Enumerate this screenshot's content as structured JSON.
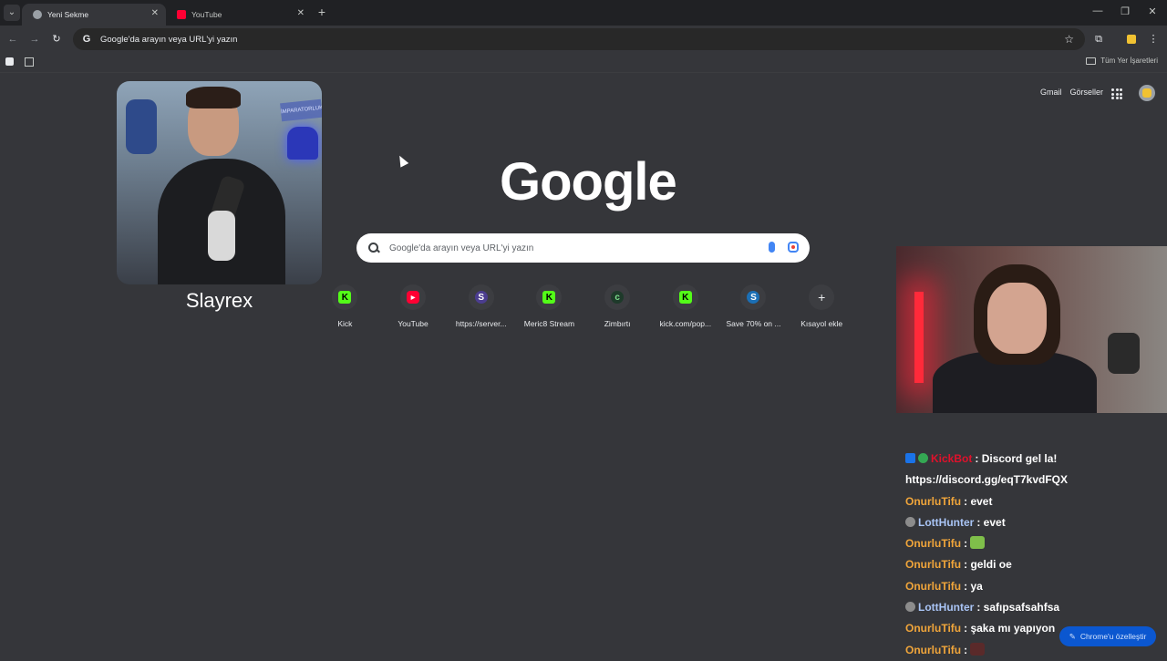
{
  "tabs": [
    {
      "title": "Yeni Sekme",
      "icon": "chrome-icon",
      "active": true
    },
    {
      "title": "YouTube",
      "icon": "youtube-icon",
      "active": false
    }
  ],
  "toolbar": {
    "omnibox_text": "Google'da arayın veya URL'yi yazın"
  },
  "bookmarks": {
    "all_bookmarks": "Tüm Yer İşaretleri"
  },
  "header_links": {
    "gmail": "Gmail",
    "images": "Görseller"
  },
  "search": {
    "logo": "Google",
    "placeholder": "Google'da arayın veya URL'yi yazın"
  },
  "shortcuts": [
    {
      "label": "Kick",
      "glyph": "K",
      "color": "#53fc18"
    },
    {
      "label": "YouTube",
      "glyph": "▶",
      "color": "#ff0033"
    },
    {
      "label": "https://server...",
      "glyph": "S",
      "color": "#7b68ee"
    },
    {
      "label": "Meric8 Stream",
      "glyph": "K",
      "color": "#53fc18"
    },
    {
      "label": "Zimbırtı",
      "glyph": "c",
      "color": "#1e8e3e"
    },
    {
      "label": "kick.com/pop...",
      "glyph": "K",
      "color": "#53fc18"
    },
    {
      "label": "Save 70% on ...",
      "glyph": "S",
      "color": "#1b6fb5"
    },
    {
      "label": "Kısayol ekle",
      "glyph": "+",
      "color": "#e8eaed"
    }
  ],
  "streamer": {
    "name": "Slayrex",
    "neon_sign": "İMPARATORLUK"
  },
  "chat": [
    {
      "user": "KickBot",
      "color": "#e0112b",
      "message": "Discord gel la!"
    },
    {
      "user": "",
      "color": "#ffffff",
      "message": "https://discord.gg/eqT7kvdFQX"
    },
    {
      "user": "OnurluTifu",
      "color": "#f0a53a",
      "message": "evet"
    },
    {
      "user": "LottHunter",
      "color": "#a9c4f5",
      "message": "evet"
    },
    {
      "user": "OnurluTifu",
      "color": "#f0a53a",
      "message": ""
    },
    {
      "user": "OnurluTifu",
      "color": "#f0a53a",
      "message": "geldi oe"
    },
    {
      "user": "OnurluTifu",
      "color": "#f0a53a",
      "message": "ya"
    },
    {
      "user": "LottHunter",
      "color": "#a9c4f5",
      "message": "safıpsafsahfsa"
    },
    {
      "user": "OnurluTifu",
      "color": "#f0a53a",
      "message": "şaka mı yapıyon"
    },
    {
      "user": "OnurluTifu",
      "color": "#f0a53a",
      "message": ""
    }
  ],
  "customize_button": "Chrome'u özelleştir"
}
